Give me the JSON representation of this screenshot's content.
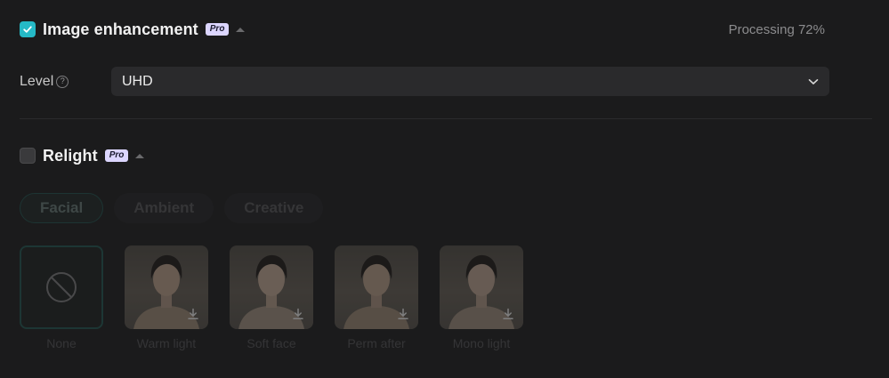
{
  "image_enhancement": {
    "title": "Image enhancement",
    "badge": "Pro",
    "checked": true,
    "status": "Processing 72%",
    "progress_percent": 72,
    "level_label": "Level",
    "level_value": "UHD"
  },
  "relight": {
    "title": "Relight",
    "badge": "Pro",
    "checked": false,
    "tabs": [
      {
        "label": "Facial",
        "active": true
      },
      {
        "label": "Ambient",
        "active": false
      },
      {
        "label": "Creative",
        "active": false
      }
    ],
    "presets": [
      {
        "label": "None",
        "selected": true
      },
      {
        "label": "Warm light"
      },
      {
        "label": "Soft face"
      },
      {
        "label": "Perm after"
      },
      {
        "label": "Mono light"
      }
    ]
  },
  "colors": {
    "accent": "#25b9c6",
    "badge_bg": "#dcd6ff",
    "panel_bg": "#1b1b1c",
    "select_bg": "#2a2a2c"
  },
  "icons": {
    "checkbox_checked": "check-icon",
    "collapse": "caret-up-icon",
    "help": "question-circle-icon",
    "dropdown": "chevron-down-icon",
    "none_preset": "prohibited-icon",
    "download": "download-icon"
  }
}
